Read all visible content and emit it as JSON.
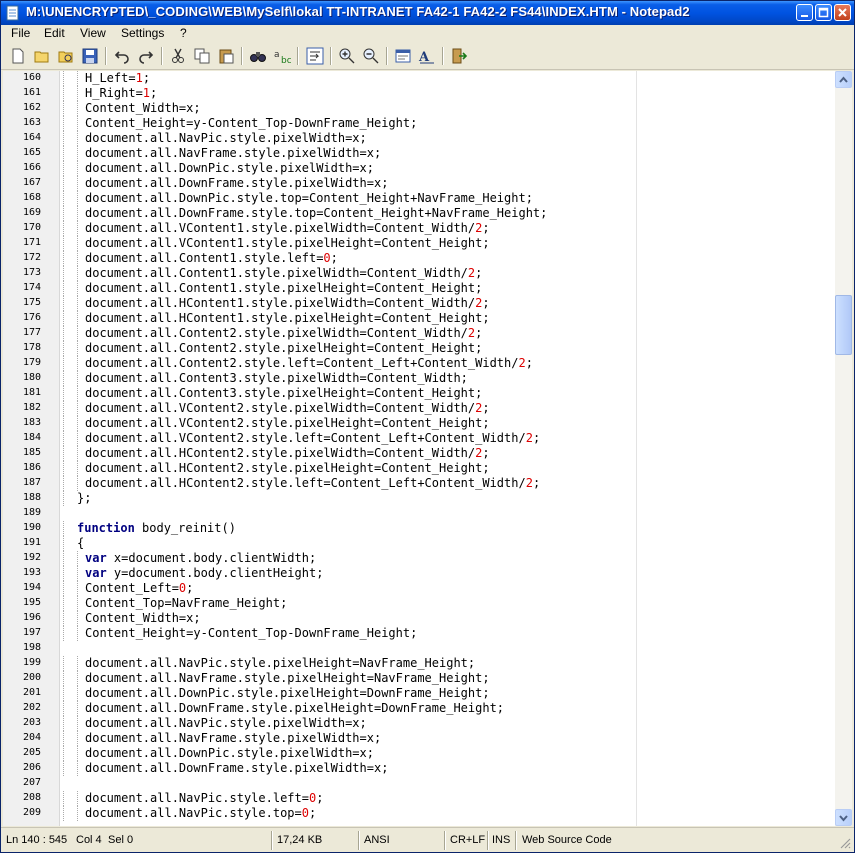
{
  "window": {
    "title": "M:\\UNENCRYPTED\\_CODING\\WEB\\MySelf\\lokal TT-INTRANET FA42-1 FA42-2 FS44\\INDEX.HTM - Notepad2"
  },
  "menu": [
    "File",
    "Edit",
    "View",
    "Settings",
    "?"
  ],
  "toolbar_icons": [
    "new-file-icon",
    "open-file-icon",
    "browse-icon",
    "save-icon",
    "undo-icon",
    "redo-icon",
    "cut-icon",
    "copy-icon",
    "paste-icon",
    "find-icon",
    "replace-icon",
    "word-wrap-icon",
    "zoom-in-icon",
    "zoom-out-icon",
    "scheme-icon",
    "font-icon",
    "exit-icon"
  ],
  "editor": {
    "lines": [
      {
        "n": "160",
        "g": 1,
        "t": "H_Left=1;"
      },
      {
        "n": "161",
        "g": 1,
        "t": "H_Right=1;"
      },
      {
        "n": "162",
        "g": 1,
        "t": "Content_Width=x;"
      },
      {
        "n": "163",
        "g": 1,
        "t": "Content_Height=y-Content_Top-DownFrame_Height;"
      },
      {
        "n": "164",
        "g": 1,
        "t": "document.all.NavPic.style.pixelWidth=x;"
      },
      {
        "n": "165",
        "g": 1,
        "t": "document.all.NavFrame.style.pixelWidth=x;"
      },
      {
        "n": "166",
        "g": 1,
        "t": "document.all.DownPic.style.pixelWidth=x;"
      },
      {
        "n": "167",
        "g": 1,
        "t": "document.all.DownFrame.style.pixelWidth=x;"
      },
      {
        "n": "168",
        "g": 1,
        "t": "document.all.DownPic.style.top=Content_Height+NavFrame_Height;"
      },
      {
        "n": "169",
        "g": 1,
        "t": "document.all.DownFrame.style.top=Content_Height+NavFrame_Height;"
      },
      {
        "n": "170",
        "g": 1,
        "t": "document.all.VContent1.style.pixelWidth=Content_Width/2;"
      },
      {
        "n": "171",
        "g": 1,
        "t": "document.all.VContent1.style.pixelHeight=Content_Height;"
      },
      {
        "n": "172",
        "g": 1,
        "t": "document.all.Content1.style.left=0;"
      },
      {
        "n": "173",
        "g": 1,
        "t": "document.all.Content1.style.pixelWidth=Content_Width/2;"
      },
      {
        "n": "174",
        "g": 1,
        "t": "document.all.Content1.style.pixelHeight=Content_Height;"
      },
      {
        "n": "175",
        "g": 1,
        "t": "document.all.HContent1.style.pixelWidth=Content_Width/2;"
      },
      {
        "n": "176",
        "g": 1,
        "t": "document.all.HContent1.style.pixelHeight=Content_Height;"
      },
      {
        "n": "177",
        "g": 1,
        "t": "document.all.Content2.style.pixelWidth=Content_Width/2;"
      },
      {
        "n": "178",
        "g": 1,
        "t": "document.all.Content2.style.pixelHeight=Content_Height;"
      },
      {
        "n": "179",
        "g": 1,
        "t": "document.all.Content2.style.left=Content_Left+Content_Width/2;"
      },
      {
        "n": "180",
        "g": 1,
        "t": "document.all.Content3.style.pixelWidth=Content_Width;"
      },
      {
        "n": "181",
        "g": 1,
        "t": "document.all.Content3.style.pixelHeight=Content_Height;"
      },
      {
        "n": "182",
        "g": 1,
        "t": "document.all.VContent2.style.pixelWidth=Content_Width/2;"
      },
      {
        "n": "183",
        "g": 1,
        "t": "document.all.VContent2.style.pixelHeight=Content_Height;"
      },
      {
        "n": "184",
        "g": 1,
        "t": "document.all.VContent2.style.left=Content_Left+Content_Width/2;"
      },
      {
        "n": "185",
        "g": 1,
        "t": "document.all.HContent2.style.pixelWidth=Content_Width/2;"
      },
      {
        "n": "186",
        "g": 1,
        "t": "document.all.HContent2.style.pixelHeight=Content_Height;"
      },
      {
        "n": "187",
        "g": 1,
        "t": "document.all.HContent2.style.left=Content_Left+Content_Width/2;"
      },
      {
        "n": "188",
        "g": 0,
        "t": "};"
      },
      {
        "n": "189",
        "g": 0,
        "t": ""
      },
      {
        "n": "190",
        "g": 0,
        "t": "function body_reinit()"
      },
      {
        "n": "191",
        "g": 0,
        "t": "{"
      },
      {
        "n": "192",
        "g": 1,
        "t": "var x=document.body.clientWidth;"
      },
      {
        "n": "193",
        "g": 1,
        "t": "var y=document.body.clientHeight;"
      },
      {
        "n": "194",
        "g": 1,
        "t": "Content_Left=0;"
      },
      {
        "n": "195",
        "g": 1,
        "t": "Content_Top=NavFrame_Height;"
      },
      {
        "n": "196",
        "g": 1,
        "t": "Content_Width=x;"
      },
      {
        "n": "197",
        "g": 1,
        "t": "Content_Height=y-Content_Top-DownFrame_Height;"
      },
      {
        "n": "198",
        "g": 0,
        "t": ""
      },
      {
        "n": "199",
        "g": 1,
        "t": "document.all.NavPic.style.pixelHeight=NavFrame_Height;"
      },
      {
        "n": "200",
        "g": 1,
        "t": "document.all.NavFrame.style.pixelHeight=NavFrame_Height;"
      },
      {
        "n": "201",
        "g": 1,
        "t": "document.all.DownPic.style.pixelHeight=DownFrame_Height;"
      },
      {
        "n": "202",
        "g": 1,
        "t": "document.all.DownFrame.style.pixelHeight=DownFrame_Height;"
      },
      {
        "n": "203",
        "g": 1,
        "t": "document.all.NavPic.style.pixelWidth=x;"
      },
      {
        "n": "204",
        "g": 1,
        "t": "document.all.NavFrame.style.pixelWidth=x;"
      },
      {
        "n": "205",
        "g": 1,
        "t": "document.all.DownPic.style.pixelWidth=x;"
      },
      {
        "n": "206",
        "g": 1,
        "t": "document.all.DownFrame.style.pixelWidth=x;"
      },
      {
        "n": "207",
        "g": 0,
        "t": ""
      },
      {
        "n": "208",
        "g": 1,
        "t": "document.all.NavPic.style.left=0;"
      },
      {
        "n": "209",
        "g": 1,
        "t": "document.all.NavPic.style.top=0;"
      }
    ]
  },
  "status": {
    "position": "Ln 140 : 545",
    "col": "Col 4",
    "sel": "Sel 0",
    "size": "17,24 KB",
    "encoding": "ANSI",
    "eol": "CR+LF",
    "ins": "INS",
    "scheme": "Web Source Code"
  },
  "colors": {
    "keyword": "#000080",
    "number": "#dd0000",
    "title_bar": "#0054e3"
  }
}
